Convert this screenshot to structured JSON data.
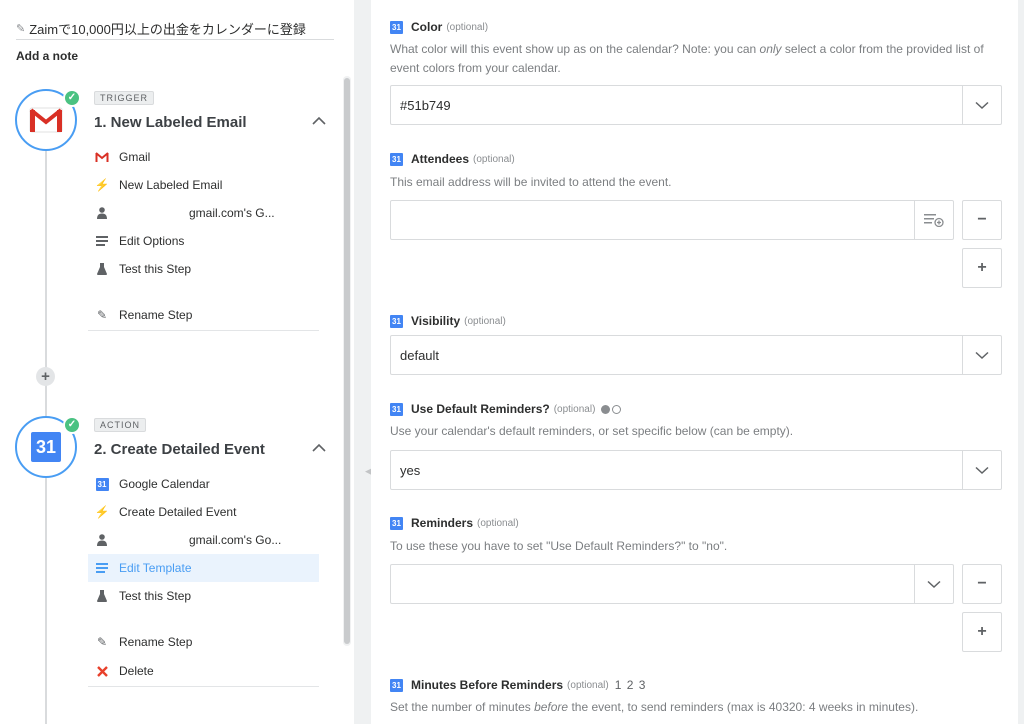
{
  "zap": {
    "title": "Zaimで10,000円以上の出金をカレンダーに登録",
    "add_note": "Add a note"
  },
  "steps": [
    {
      "tag": "TRIGGER",
      "title": "1. New Labeled Email",
      "app": "Gmail",
      "event": "New Labeled Email",
      "account": "gmail.com's G...",
      "edit": "Edit Options",
      "test": "Test this Step",
      "rename": "Rename Step"
    },
    {
      "tag": "ACTION",
      "title": "2. Create Detailed Event",
      "app": "Google Calendar",
      "event": "Create Detailed Event",
      "account": "gmail.com's Go...",
      "edit": "Edit Template",
      "test": "Test this Step",
      "rename": "Rename Step",
      "delete": "Delete"
    }
  ],
  "form": {
    "optional": "(optional)",
    "color": {
      "label": "Color",
      "help_1": "What color will this event show up as on the calendar? Note: you can ",
      "help_em": "only",
      "help_2": " select a color from the provided list of event colors from your calendar.",
      "value": "#51b749"
    },
    "attendees": {
      "label": "Attendees",
      "help": "This email address will be invited to attend the event."
    },
    "visibility": {
      "label": "Visibility",
      "value": "default"
    },
    "use_default_reminders": {
      "label": "Use Default Reminders?",
      "help": "Use your calendar's default reminders, or set specific below (can be empty).",
      "value": "yes"
    },
    "reminders": {
      "label": "Reminders",
      "help": "To use these you have to set \"Use Default Reminders?\" to \"no\"."
    },
    "minutes_before": {
      "label": "Minutes Before Reminders",
      "links": "1 2 3",
      "help_1": "Set the number of minutes ",
      "help_em": "before",
      "help_2": " the event, to send reminders (max is 40320: 4 weeks in minutes)."
    }
  },
  "icons": {
    "calendar_glyph": "31",
    "plus": "+",
    "minus": "−",
    "check": "✓"
  },
  "colors": {
    "accent": "#499df3",
    "success": "#4ac282",
    "gmail_red": "#d93025",
    "gcal_blue": "#4285f4"
  }
}
